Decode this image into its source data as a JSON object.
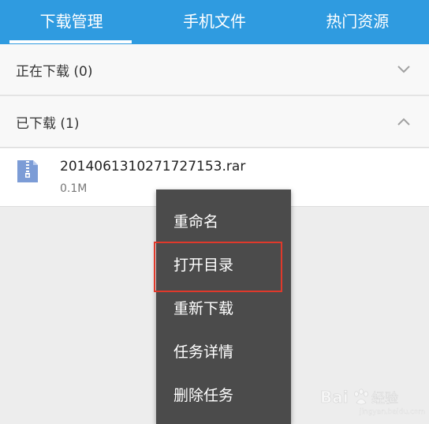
{
  "tabs": [
    {
      "label": "下载管理",
      "active": true
    },
    {
      "label": "手机文件",
      "active": false
    },
    {
      "label": "热门资源",
      "active": false
    }
  ],
  "sections": {
    "downloading": {
      "title": "正在下载 (0)",
      "expanded": false
    },
    "downloaded": {
      "title": "已下载 (1)",
      "expanded": true
    }
  },
  "file": {
    "name": "20140613102717271 53.rar",
    "size": "0.1M",
    "icon": "archive-file-icon"
  },
  "context_menu": {
    "items": [
      {
        "label": "重命名"
      },
      {
        "label": "打开目录",
        "highlighted": true
      },
      {
        "label": "重新下载"
      },
      {
        "label": "任务详情"
      },
      {
        "label": "删除任务"
      }
    ]
  },
  "watermark": {
    "logo_text": "Bai du 经验",
    "url": "jingyan.baidu.com"
  },
  "colors": {
    "tab_bar": "#2f9be0",
    "menu_bg": "#4b4b4b",
    "highlight": "#e0392b",
    "page_bg": "#ededed"
  }
}
